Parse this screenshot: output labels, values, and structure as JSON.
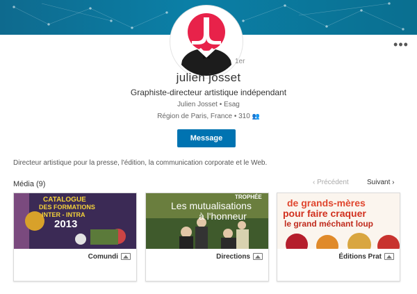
{
  "profile": {
    "degree": "1er",
    "name": "julien josset",
    "headline": "Graphiste-directeur artistique indépendant",
    "company": "Julien Josset • Esag",
    "location": "Région de Paris, France • 310",
    "connections_icon": "people-icon"
  },
  "actions": {
    "message_label": "Message",
    "more_icon": "more-horizontal-icon",
    "more_label": "•••"
  },
  "summary": "Directeur artistique pour la presse, l'édition, la communication corporate et le Web.",
  "media": {
    "title": "Média (9)",
    "prev_label": "‹  Précédent",
    "next_label": "Suivant  ›",
    "items": [
      {
        "caption": "Comundi",
        "thumb_lines": [
          "CATALOGUE",
          "DES FORMATIONS",
          "INTER - INTRA",
          "2013"
        ]
      },
      {
        "caption": "Directions",
        "thumb_lines": [
          "TROPHÉE",
          "Les mutualisations",
          "à l'honneur"
        ]
      },
      {
        "caption": "Éditions Prat",
        "thumb_lines": [
          "de grands-mères",
          "pour faire craquer",
          "le grand méchant loup"
        ]
      }
    ]
  },
  "colors": {
    "accent": "#0073b1",
    "banner": "#0b7fa6",
    "avatar_red": "#e8224a"
  }
}
